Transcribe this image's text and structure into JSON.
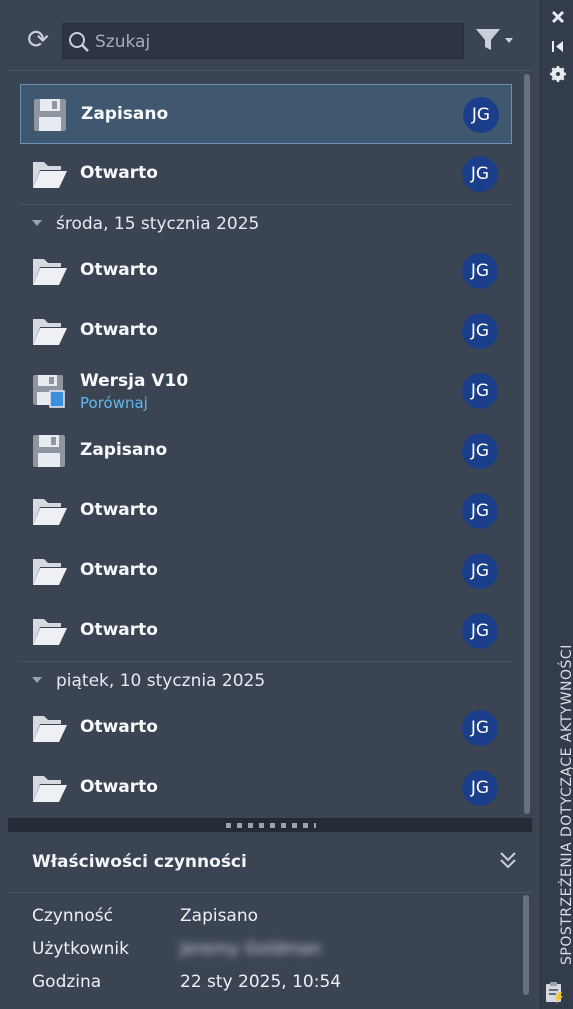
{
  "search": {
    "placeholder": "Szukaj"
  },
  "top_rows": [
    {
      "label": "Zapisano",
      "avatar": "JG",
      "icon": "save-icon"
    },
    {
      "label": "Otwarto",
      "avatar": "JG",
      "icon": "folder-open-icon"
    }
  ],
  "day1": {
    "label": "środa, 15 stycznia 2025",
    "rows": [
      {
        "label": "Otwarto",
        "avatar": "JG",
        "icon": "folder-open-icon"
      },
      {
        "label": "Otwarto",
        "avatar": "JG",
        "icon": "folder-open-icon"
      },
      {
        "label": "Wersja V10",
        "sublabel": "Porównaj",
        "avatar": "JG",
        "icon": "version-save-icon"
      },
      {
        "label": "Zapisano",
        "avatar": "JG",
        "icon": "save-icon"
      },
      {
        "label": "Otwarto",
        "avatar": "JG",
        "icon": "folder-open-icon"
      },
      {
        "label": "Otwarto",
        "avatar": "JG",
        "icon": "folder-open-icon"
      },
      {
        "label": "Otwarto",
        "avatar": "JG",
        "icon": "folder-open-icon"
      }
    ]
  },
  "day2": {
    "label": "piątek, 10 stycznia 2025",
    "rows": [
      {
        "label": "Otwarto",
        "avatar": "JG",
        "icon": "folder-open-icon"
      },
      {
        "label": "Otwarto",
        "avatar": "JG",
        "icon": "folder-open-icon"
      }
    ]
  },
  "props": {
    "title": "Właściwości czynności",
    "rows": [
      {
        "key": "Czynność",
        "value": "Zapisano"
      },
      {
        "key": "Użytkownik",
        "value": "Jeremy Goldman"
      },
      {
        "key": "Godzina",
        "value": "22 sty 2025, 10:54"
      }
    ]
  },
  "side": {
    "title": "SPOSTRZEŻENIA DOTYCZĄCE AKTYWNOŚCI"
  },
  "colors": {
    "accent_blue": "#5fb8ec",
    "avatar_bg": "#1b3e8a",
    "selection_border": "#6d92b7"
  }
}
